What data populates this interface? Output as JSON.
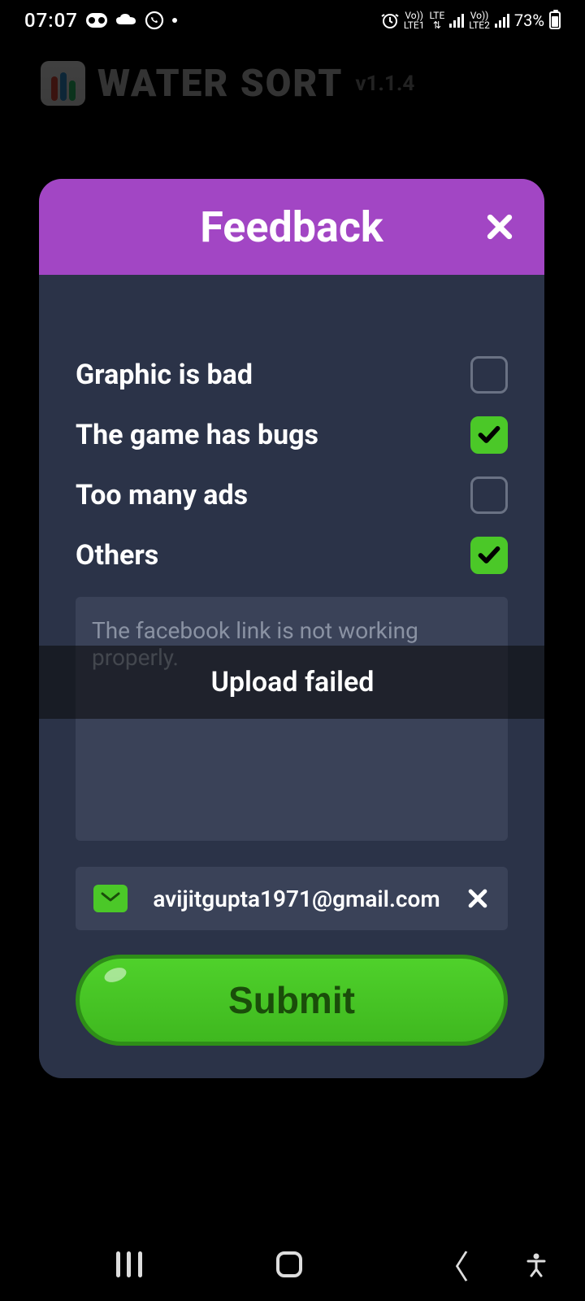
{
  "statusBar": {
    "time": "07:07",
    "battery": "73%"
  },
  "background": {
    "appTitle": "WATER SORT",
    "version": "v1.1.4"
  },
  "modal": {
    "title": "Feedback",
    "options": [
      {
        "label": "Graphic is bad",
        "checked": false
      },
      {
        "label": "The game has bugs",
        "checked": true
      },
      {
        "label": "Too many ads",
        "checked": false
      },
      {
        "label": "Others",
        "checked": true
      }
    ],
    "textarea_placeholder": "The facebook link is not working properly.",
    "toast": "Upload failed",
    "email": "avijitgupta1971@gmail.com",
    "submit_label": "Submit"
  }
}
